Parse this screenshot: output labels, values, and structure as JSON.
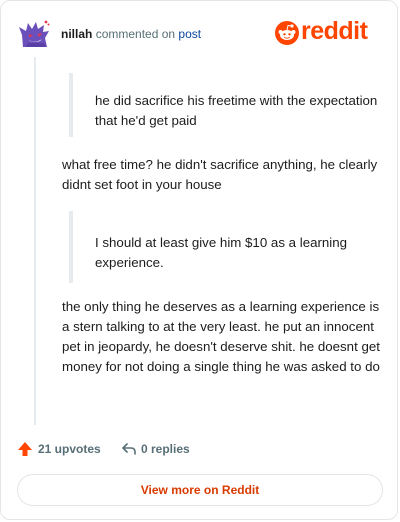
{
  "header": {
    "username": "nillah",
    "verb": "commented on",
    "link": "post",
    "avatar_icon": "gengar-avatar-icon",
    "brand_icon": "reddit-snoo-icon",
    "brand_name": "reddit",
    "brand_color": "#ff4500"
  },
  "comment": {
    "quote1": "he did sacrifice his freetime with the expectation that he'd get paid",
    "para1": "what free time? he didn't sacrifice anything, he clearly didnt set foot in your house",
    "quote2": "I should at least give him $10 as a learning experience.",
    "para2": "the only thing he deserves as a learning experience is a stern talking to at the very least. he put an innocent pet in jeopardy, he doesn't deserve shit. he doesnt get money for not doing a single thing he was asked to do"
  },
  "footer": {
    "upvotes": "21 upvotes",
    "upvote_icon": "upvote-arrow-icon",
    "upvote_color": "#ff4500",
    "replies": "0 replies",
    "reply_icon": "reply-arrow-icon",
    "view_more": "View more on Reddit"
  }
}
